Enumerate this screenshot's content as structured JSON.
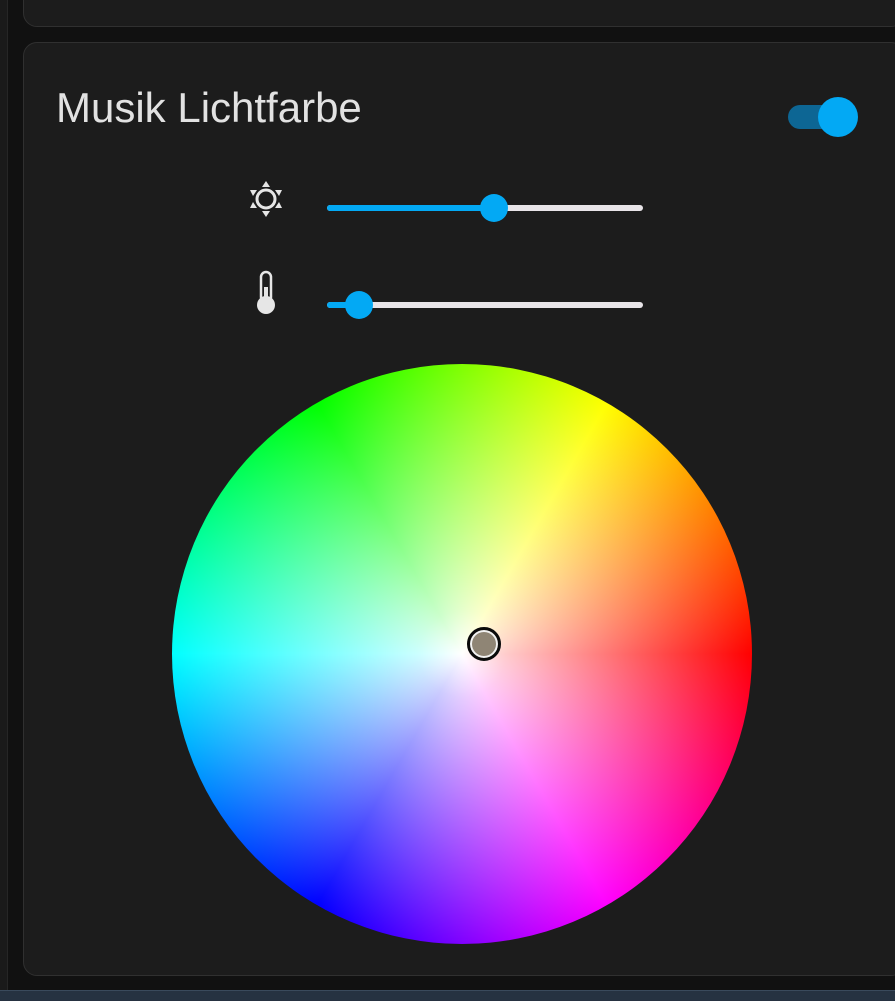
{
  "card": {
    "title": "Musik Lichtfarbe",
    "enabled": true
  },
  "controls": {
    "brightness": {
      "icon": "brightness-icon",
      "value": 0.53
    },
    "color_temp": {
      "icon": "thermometer-icon",
      "value": 0.1
    }
  },
  "color_wheel": {
    "marker_color": "#8f8575",
    "marker_offset": [
      0.073,
      -0.037
    ]
  },
  "colors": {
    "accent": "#03a9f4",
    "toggle_track": "#0d6694",
    "card_background": "#1c1c1c",
    "page_background": "#111111",
    "title_text": "#e2e2e2"
  }
}
